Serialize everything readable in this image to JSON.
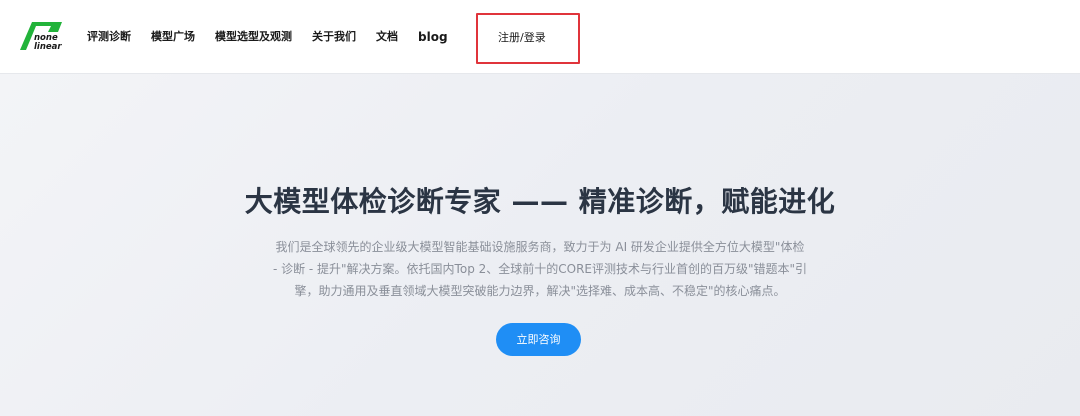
{
  "brand": {
    "logo_line1": "none",
    "logo_line2": "linear",
    "logo_color": "#22b33a"
  },
  "nav": {
    "items": [
      {
        "label": "评测诊断"
      },
      {
        "label": "模型广场"
      },
      {
        "label": "模型选型及观测"
      },
      {
        "label": "关于我们"
      },
      {
        "label": "文档"
      },
      {
        "label": "blog"
      }
    ],
    "login_label": "注册/登录",
    "highlight_color": "#e0343b"
  },
  "hero": {
    "title": "大模型体检诊断专家 —— 精准诊断，赋能进化",
    "description_lines": [
      "我们是全球领先的企业级大模型智能基础设施服务商，致力于为 AI 研发企业提供全方位大模型\"体检",
      "- 诊断 - 提升\"解决方案。依托国内Top 2、全球前十的CORE评测技术与行业首创的百万级\"错题本\"引",
      "擎，助力通用及垂直领域大模型突破能力边界，解决\"选择难、成本高、不稳定\"的核心痛点。"
    ],
    "cta_label": "立即咨询",
    "cta_color": "#1f8ef5"
  }
}
